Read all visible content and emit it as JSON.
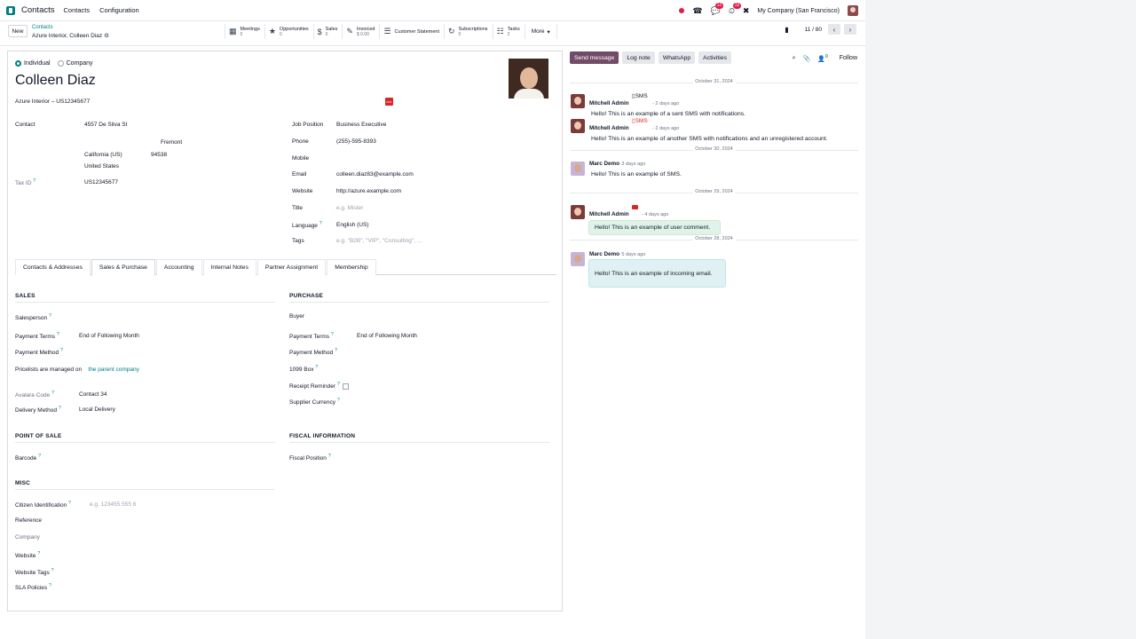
{
  "navbar": {
    "app_name": "Contacts",
    "menus": [
      "Contacts",
      "Configuration"
    ],
    "messages_badge": "12",
    "activities_badge": "32",
    "company": "My Company (San Francisco)"
  },
  "control": {
    "new_label": "New",
    "breadcrumb_parent": "Contacts",
    "breadcrumb_current": "Azure Interior, Colleen Diaz",
    "smart_buttons": [
      {
        "icon": "calendar-icon",
        "glyph": "▦",
        "label": "Meetings",
        "value": "0"
      },
      {
        "icon": "star-icon",
        "glyph": "★",
        "label": "Opportunities",
        "value": "0"
      },
      {
        "icon": "dollar-icon",
        "glyph": "$",
        "label": "Sales",
        "value": "0"
      },
      {
        "icon": "invoice-icon",
        "glyph": "✎",
        "label": "Invoiced",
        "value": "$ 0.00"
      },
      {
        "icon": "list-icon",
        "glyph": "☰",
        "label": "Customer Statement",
        "value": ""
      },
      {
        "icon": "refresh-icon",
        "glyph": "↻",
        "label": "Subscriptions",
        "value": "0"
      },
      {
        "icon": "tasks-icon",
        "glyph": "☷",
        "label": "Tasks",
        "value": "2"
      }
    ],
    "more_label": "More",
    "pager": "11 / 80"
  },
  "form": {
    "type_individual": "Individual",
    "type_company": "Company",
    "name": "Colleen Diaz",
    "subtitle": "Azure Interior – US12345677",
    "contact_label": "Contact",
    "street": "4557 De Silva St",
    "city": "Fremont",
    "state": "California (US)",
    "zip": "94538",
    "country": "United States",
    "tax_id_label": "Tax ID",
    "tax_id": "US12345677",
    "job_position_label": "Job Position",
    "job_position": "Business Executive",
    "phone_label": "Phone",
    "phone": "(255)-595-8393",
    "mobile_label": "Mobile",
    "email_label": "Email",
    "email": "colleen.diaz83@example.com",
    "website_label": "Website",
    "website": "http://azure.example.com",
    "title_label": "Title",
    "title_placeholder": "e.g. Mister",
    "language_label": "Language",
    "language": "English (US)",
    "tags_label": "Tags",
    "tags_placeholder": "e.g. \"B2B\", \"VIP\", \"Consulting\", ..."
  },
  "tabs": [
    "Contacts & Addresses",
    "Sales & Purchase",
    "Accounting",
    "Internal Notes",
    "Partner Assignment",
    "Membership"
  ],
  "sales": {
    "heading": "SALES",
    "salesperson_label": "Salesperson",
    "payment_terms_label": "Payment Terms",
    "payment_terms": "End of Following Month",
    "payment_method_label": "Payment Method",
    "pricelist_text": "Pricelists are managed on",
    "pricelist_link": "the parent company",
    "avalara_label": "Avalara Code",
    "avalara": "Contact 34",
    "delivery_label": "Delivery Method",
    "delivery": "Local Delivery"
  },
  "purchase": {
    "heading": "PURCHASE",
    "buyer_label": "Buyer",
    "payment_terms_label": "Payment Terms",
    "payment_terms": "End of Following Month",
    "payment_method_label": "Payment Method",
    "box_1099_label": "1099 Box",
    "receipt_label": "Receipt Reminder",
    "currency_label": "Supplier Currency"
  },
  "pos": {
    "heading": "POINT OF SALE",
    "barcode_label": "Barcode"
  },
  "fiscal": {
    "heading": "FISCAL INFORMATION",
    "position_label": "Fiscal Position"
  },
  "misc": {
    "heading": "MISC",
    "citizen_label": "Citizen Identification",
    "citizen_placeholder": "e.g. 123455 555 6",
    "reference_label": "Reference",
    "company_label": "Company",
    "website_label": "Website",
    "website_tags_label": "Website Tags",
    "sla_label": "SLA Policies"
  },
  "chatter": {
    "send_message": "Send message",
    "log_note": "Log note",
    "whatsapp": "WhatsApp",
    "activities": "Activities",
    "follower_count": "0",
    "follow": "Follow",
    "dates": [
      "October 31, 2024",
      "October 30, 2024",
      "October 29, 2024",
      "October 28, 2024"
    ],
    "messages": [
      {
        "author": "Mitchell Admin",
        "time": "- 2 days ago",
        "tag": "SMS",
        "body": "Hello! This is an example of a sent SMS with notifications."
      },
      {
        "author": "Mitchell Admin",
        "time": "- 2 days ago",
        "tag": "SMS",
        "body": "Hello! This is an example of another SMS with notifications and an unregistered account."
      },
      {
        "author": "Marc Demo",
        "time": "- 3 days ago",
        "body": "Hello! This is an example of SMS."
      },
      {
        "author": "Mitchell Admin",
        "time": "- 4 days ago",
        "body": "Hello! This is an example of user comment."
      },
      {
        "author": "Marc Demo",
        "time": "- 5 days ago",
        "body": "Hello! This is an example of incoming email."
      }
    ]
  },
  "colors": {
    "accent": "#017e84",
    "primary": "#714b67",
    "danger": "#e11d48"
  }
}
